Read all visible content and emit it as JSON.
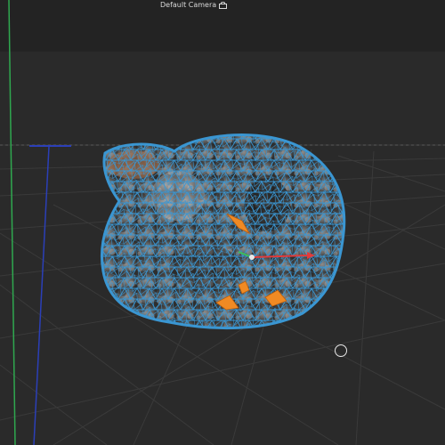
{
  "viewport": {
    "camera_label": "Default Camera",
    "camera_icon": "camera-lock-icon"
  },
  "colors": {
    "background": "#2a2a2a",
    "topbar": "#232323",
    "grid": "#3a3a3a",
    "y_axis": "#2fa84f",
    "z_axis": "#2b3fb8",
    "wireframe": "#3a96d2",
    "gizmo_x": "#e23b3b",
    "gizmo_y": "#3cc05a",
    "bone": "#f08a24"
  },
  "cursor_icon": "cursor-ring-icon"
}
